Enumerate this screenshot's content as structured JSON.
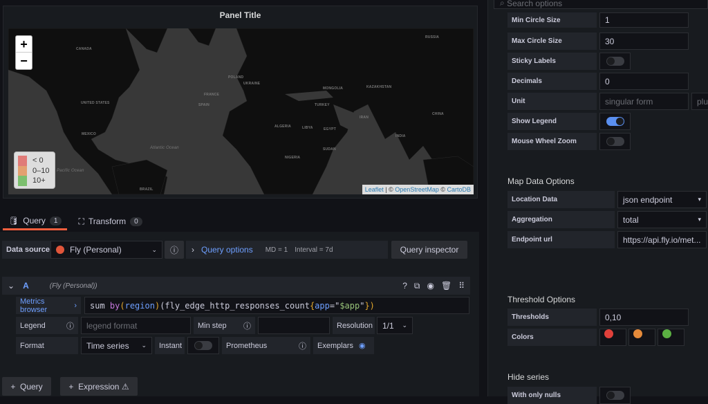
{
  "panel": {
    "title": "Panel Title",
    "zoom_in": "+",
    "zoom_out": "−",
    "legend": [
      {
        "label": "< 0",
        "color": "#e07b78"
      },
      {
        "label": "0–10",
        "color": "#e3a070"
      },
      {
        "label": "10+",
        "color": "#7cbf6e"
      }
    ],
    "attribution": {
      "leaflet": "Leaflet",
      "sep": " | © ",
      "osm": "OpenStreetMap",
      "sep2": " © ",
      "carto": "CartoDB"
    },
    "map_labels": [
      "CANADA",
      "UNITED STATES",
      "MEXICO",
      "RUSSIA",
      "KAZAKHSTAN",
      "CHINA",
      "INDIA",
      "IRAN",
      "TURKEY",
      "ALGERIA",
      "LIBYA",
      "EGYPT",
      "SUDAN",
      "NIGERIA",
      "BRAZIL",
      "Atlantic Ocean",
      "Pacific Ocean",
      "MONGOLIA",
      "UKRAINE",
      "POLAND",
      "FRANCE",
      "SPAIN"
    ]
  },
  "tabs": [
    {
      "label": "Query",
      "count": "1"
    },
    {
      "label": "Transform",
      "count": "0"
    }
  ],
  "toolbar": {
    "data_source_label": "Data source",
    "data_source": "Fly (Personal)",
    "query_options": "Query options",
    "md": "MD = 1",
    "interval": "Interval = 7d",
    "query_inspector": "Query inspector"
  },
  "query": {
    "ref": "A",
    "source": "(Fly (Personal))",
    "metrics_browser": "Metrics browser",
    "expr": [
      {
        "t": "sum ",
        "c": "#ccccdc"
      },
      {
        "t": "by",
        "c": "#c678dd"
      },
      {
        "t": "(",
        "c": "#e5a82b"
      },
      {
        "t": "region",
        "c": "#6e9fff"
      },
      {
        "t": ")",
        "c": "#e5a82b"
      },
      {
        "t": "(fly_edge_http_responses_count",
        "c": "#ccccdc"
      },
      {
        "t": "{",
        "c": "#e5a82b"
      },
      {
        "t": "app",
        "c": "#6e9fff"
      },
      {
        "t": "=\"",
        "c": "#ccccdc"
      },
      {
        "t": "$app",
        "c": "#98c379"
      },
      {
        "t": "\"",
        "c": "#ccccdc"
      },
      {
        "t": "})",
        "c": "#e5a82b"
      }
    ],
    "legend_label": "Legend",
    "legend_placeholder": "legend format",
    "min_step_label": "Min step",
    "resolution_label": "Resolution",
    "resolution": "1/1",
    "format_label": "Format",
    "format": "Time series",
    "instant_label": "Instant",
    "prometheus_label": "Prometheus",
    "exemplars_label": "Exemplars"
  },
  "bottom": {
    "add_query": "Query",
    "add_expression": "Expression"
  },
  "options": {
    "search_placeholder": "Search options",
    "fields": [
      {
        "label": "Min Circle Size",
        "value": "1"
      },
      {
        "label": "Max Circle Size",
        "value": "30"
      },
      {
        "label": "Sticky Labels",
        "toggle": false
      },
      {
        "label": "Decimals",
        "value": "0"
      },
      {
        "label": "Unit",
        "placeholder": "singular form",
        "placeholder2": "plural form"
      },
      {
        "label": "Show Legend",
        "toggle": true
      },
      {
        "label": "Mouse Wheel Zoom",
        "toggle": false
      }
    ],
    "map_data_title": "Map Data Options",
    "map_data": [
      {
        "label": "Location Data",
        "value": "json endpoint"
      },
      {
        "label": "Aggregation",
        "value": "total"
      },
      {
        "label": "Endpoint url",
        "value": "https://api.fly.io/met..."
      }
    ],
    "threshold_title": "Threshold Options",
    "thresholds_label": "Thresholds",
    "thresholds": "0,10",
    "colors_label": "Colors",
    "colors": [
      "#e0403a",
      "#e58a3a",
      "#5bb042"
    ],
    "hide_series_title": "Hide series",
    "with_only_nulls": "With only nulls"
  }
}
